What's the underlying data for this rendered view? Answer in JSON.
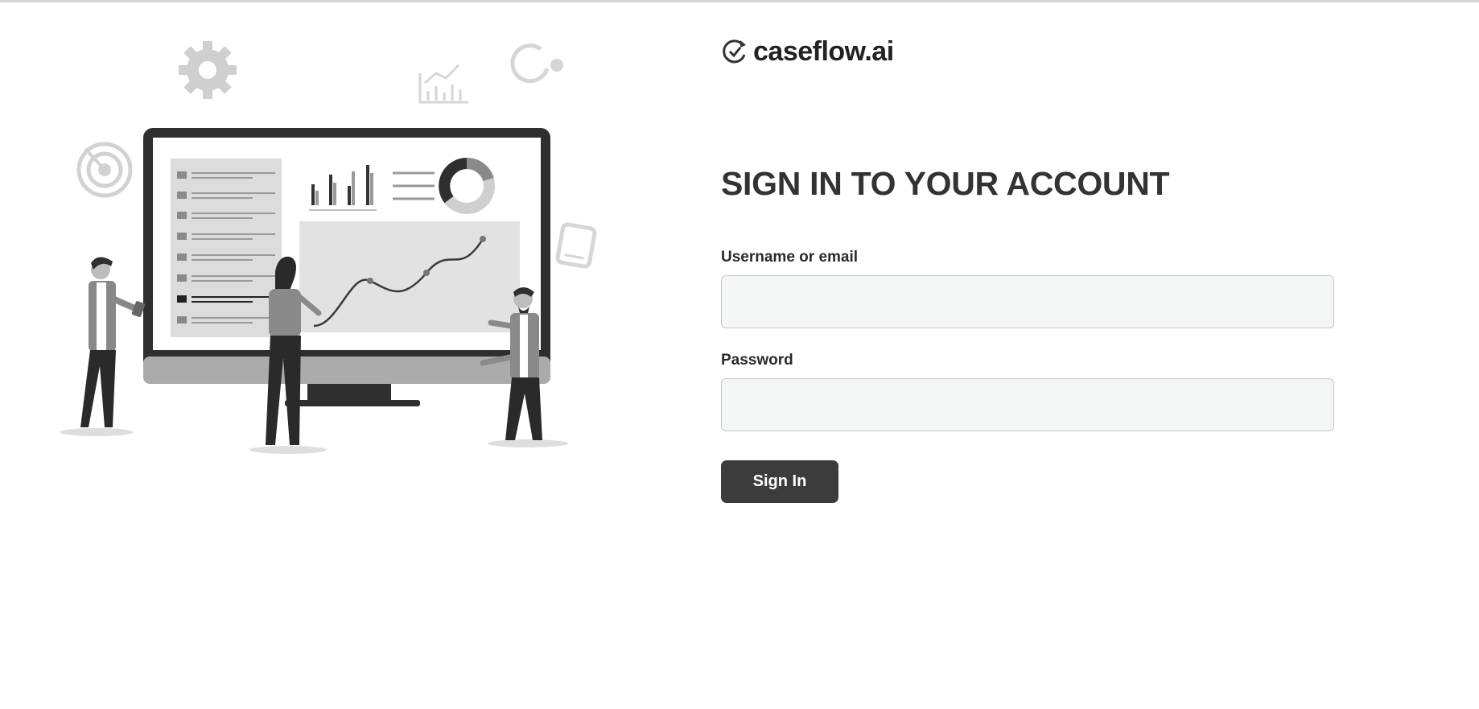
{
  "brand": {
    "name": "caseflow.ai",
    "icon": "refresh-check-icon"
  },
  "login": {
    "heading": "SIGN IN TO YOUR ACCOUNT",
    "username_label": "Username or email",
    "username_value": "",
    "password_label": "Password",
    "password_value": "",
    "submit_label": "Sign In"
  },
  "illustration": {
    "icons": [
      "gear-icon",
      "target-icon",
      "bar-chart-icon",
      "refresh-icon",
      "tablet-icon"
    ]
  },
  "colors": {
    "button_bg": "#3c3c3c",
    "input_bg": "#f4f5f5",
    "input_border": "#c6c8c8",
    "heading_text": "#333333"
  }
}
